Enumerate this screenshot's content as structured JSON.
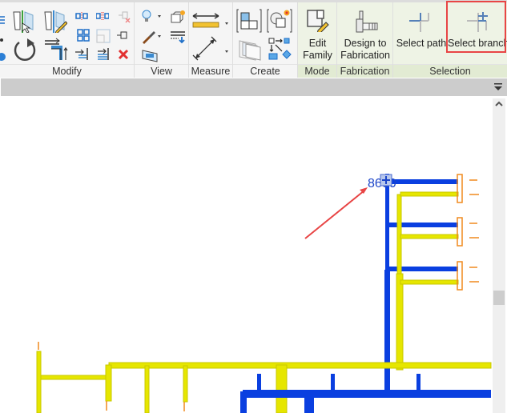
{
  "ribbon": {
    "panels": [
      {
        "id": "modify",
        "label": "Modify"
      },
      {
        "id": "view",
        "label": "View"
      },
      {
        "id": "measure",
        "label": "Measure"
      },
      {
        "id": "create",
        "label": "Create"
      },
      {
        "id": "mode",
        "label": "Mode"
      },
      {
        "id": "fabrication",
        "label": "Fabrication"
      },
      {
        "id": "selection",
        "label": "Selection"
      }
    ],
    "buttons": {
      "edit_family": {
        "line1": "Edit",
        "line2": "Family"
      },
      "design_to_fabrication": {
        "line1": "Design to",
        "line2": "Fabrication"
      },
      "select_path": {
        "label": "Select path"
      },
      "select_branch": {
        "label": "Select branch"
      }
    },
    "modify_tools": [
      "align",
      "offset",
      "mirror-pick-axis",
      "mirror-draw-axis",
      "move",
      "copy",
      "rotate",
      "trim-extend-corner",
      "split",
      "split-with-gap",
      "unpin",
      "array",
      "scale",
      "pin",
      "trim-single",
      "trim-multiple",
      "delete"
    ],
    "view_tools": [
      "hide-in-view",
      "override-graphics",
      "linework",
      "cut-profile",
      "section-box"
    ],
    "measure_tools": [
      "aligned-dimension",
      "measure-between"
    ],
    "create_tools": [
      "create-group",
      "create-similar",
      "create-parts",
      "create-assembly"
    ]
  },
  "properties_bar": {
    "menu_icon": "dropdown-menu-icon"
  },
  "canvas": {
    "dimension_label": "8600",
    "colors": {
      "supply_pipe": "#0a3fe0",
      "return_pipe": "#e6e600",
      "fixture": "#f08a1e",
      "annotation_arrow": "#e84545",
      "highlight": "#e84545"
    }
  },
  "scrollbar": {
    "up_icon": "chevron-up-icon"
  }
}
